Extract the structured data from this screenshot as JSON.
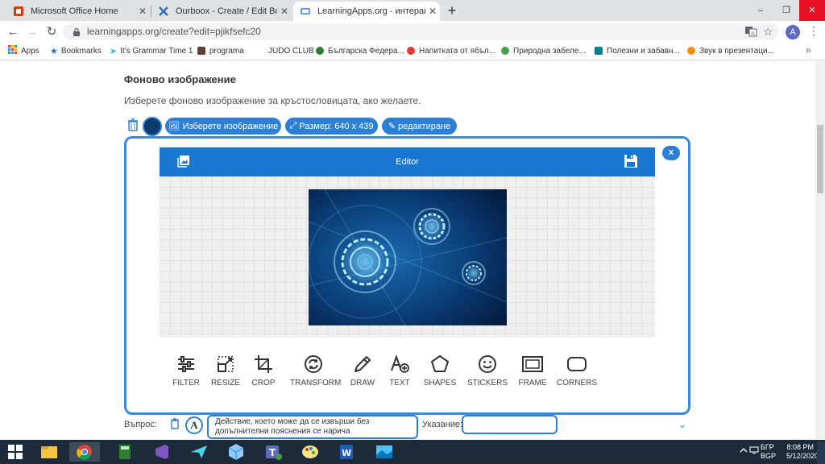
{
  "browser": {
    "tabs": [
      {
        "title": "Microsoft Office Home",
        "color": "#d83b01"
      },
      {
        "title": "Ourboox - Create / Edit Book",
        "color": "#2a6db5"
      },
      {
        "title": "LearningApps.org - интерактив",
        "color": "#6a9bd8"
      }
    ],
    "new_tab": "+",
    "window_buttons": [
      "–",
      "❐",
      "✕"
    ],
    "url": "learningapps.org/create?edit=pjikfsefc20",
    "profile_initial": "A",
    "bookmarks": [
      {
        "label": "Apps",
        "color": "#e94335"
      },
      {
        "label": "Bookmarks",
        "color": "#1a73e8"
      },
      {
        "label": "It's Grammar Time 1",
        "color": "#29b6f6"
      },
      {
        "label": "programa",
        "color": "#5d4037"
      },
      {
        "label": "JUDO CLUB",
        "color": "#ffffff"
      },
      {
        "label": "Българска Федера...",
        "color": "#2e7d32"
      },
      {
        "label": "Напитката от ябъл...",
        "color": "#e53935"
      },
      {
        "label": "Природна забеле...",
        "color": "#43a047"
      },
      {
        "label": "Полезни и забавн...",
        "color": "#00838f"
      },
      {
        "label": "Звук в презентаци...",
        "color": "#fb8c00"
      }
    ]
  },
  "page": {
    "section_title": "Фоново изображение",
    "section_desc": "Изберете фоново изображение за кръстословицата, ако желаете.",
    "buttons": {
      "choose_image": "Изберете изображение",
      "size": "Размер: 640 x 439",
      "edit": "редактиране"
    }
  },
  "editor": {
    "title": "Editor",
    "close": "x",
    "tools": [
      {
        "label": "FILTER",
        "icon": "sliders-icon"
      },
      {
        "label": "RESIZE",
        "icon": "resize-icon"
      },
      {
        "label": "CROP",
        "icon": "crop-icon"
      },
      {
        "label": "TRANSFORM",
        "icon": "rotate-icon"
      },
      {
        "label": "DRAW",
        "icon": "pencil-icon"
      },
      {
        "label": "TEXT",
        "icon": "text-add-icon"
      },
      {
        "label": "SHAPES",
        "icon": "pentagon-icon"
      },
      {
        "label": "STICKERS",
        "icon": "smiley-icon"
      },
      {
        "label": "FRAME",
        "icon": "frame-icon"
      },
      {
        "label": "CORNERS",
        "icon": "rounded-rect-icon"
      }
    ]
  },
  "form": {
    "question_label": "Въпрос:",
    "question_value_line1": "Действие, което може да се извърши без",
    "question_value_line2": "допълнителни пояснения се нарича",
    "hint_label": "Указание:"
  },
  "taskbar": {
    "lang1": "БГР",
    "lang2": "BGP",
    "time": "8:08 PM",
    "date": "5/12/2020"
  },
  "colors": {
    "accent": "#2d7fd3",
    "editor_header": "#1976d2"
  }
}
